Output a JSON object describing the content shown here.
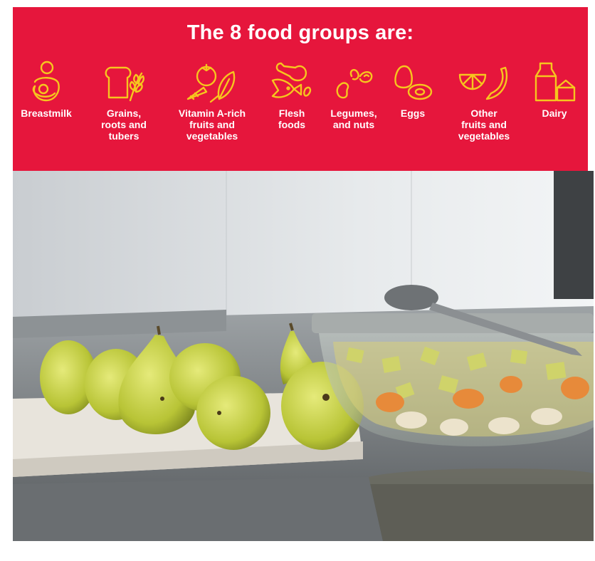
{
  "banner": {
    "background": "#e6163c",
    "icon_color": "#f6c61e",
    "title": "The 8 food groups are:",
    "groups": [
      {
        "icon": "breastfeeding-icon",
        "label": "Breastmilk"
      },
      {
        "icon": "bread-grain-icon",
        "label": "Grains,\nroots and\ntubers"
      },
      {
        "icon": "tomato-carrot-leaf-icon",
        "label": "Vitamin A-rich\nfruits and\nvegetables"
      },
      {
        "icon": "drumstick-fish-icon",
        "label": "Flesh\nfoods"
      },
      {
        "icon": "beans-icon",
        "label": "Legumes,\nand nuts"
      },
      {
        "icon": "eggs-icon",
        "label": "Eggs"
      },
      {
        "icon": "orange-banana-icon",
        "label": "Other\nfruits and\nvegetables"
      },
      {
        "icon": "milk-carton-cheese-icon",
        "label": "Dairy"
      }
    ]
  },
  "photo": {
    "subject": "pears-on-tray-and-bowl-of-fruit-salad"
  }
}
